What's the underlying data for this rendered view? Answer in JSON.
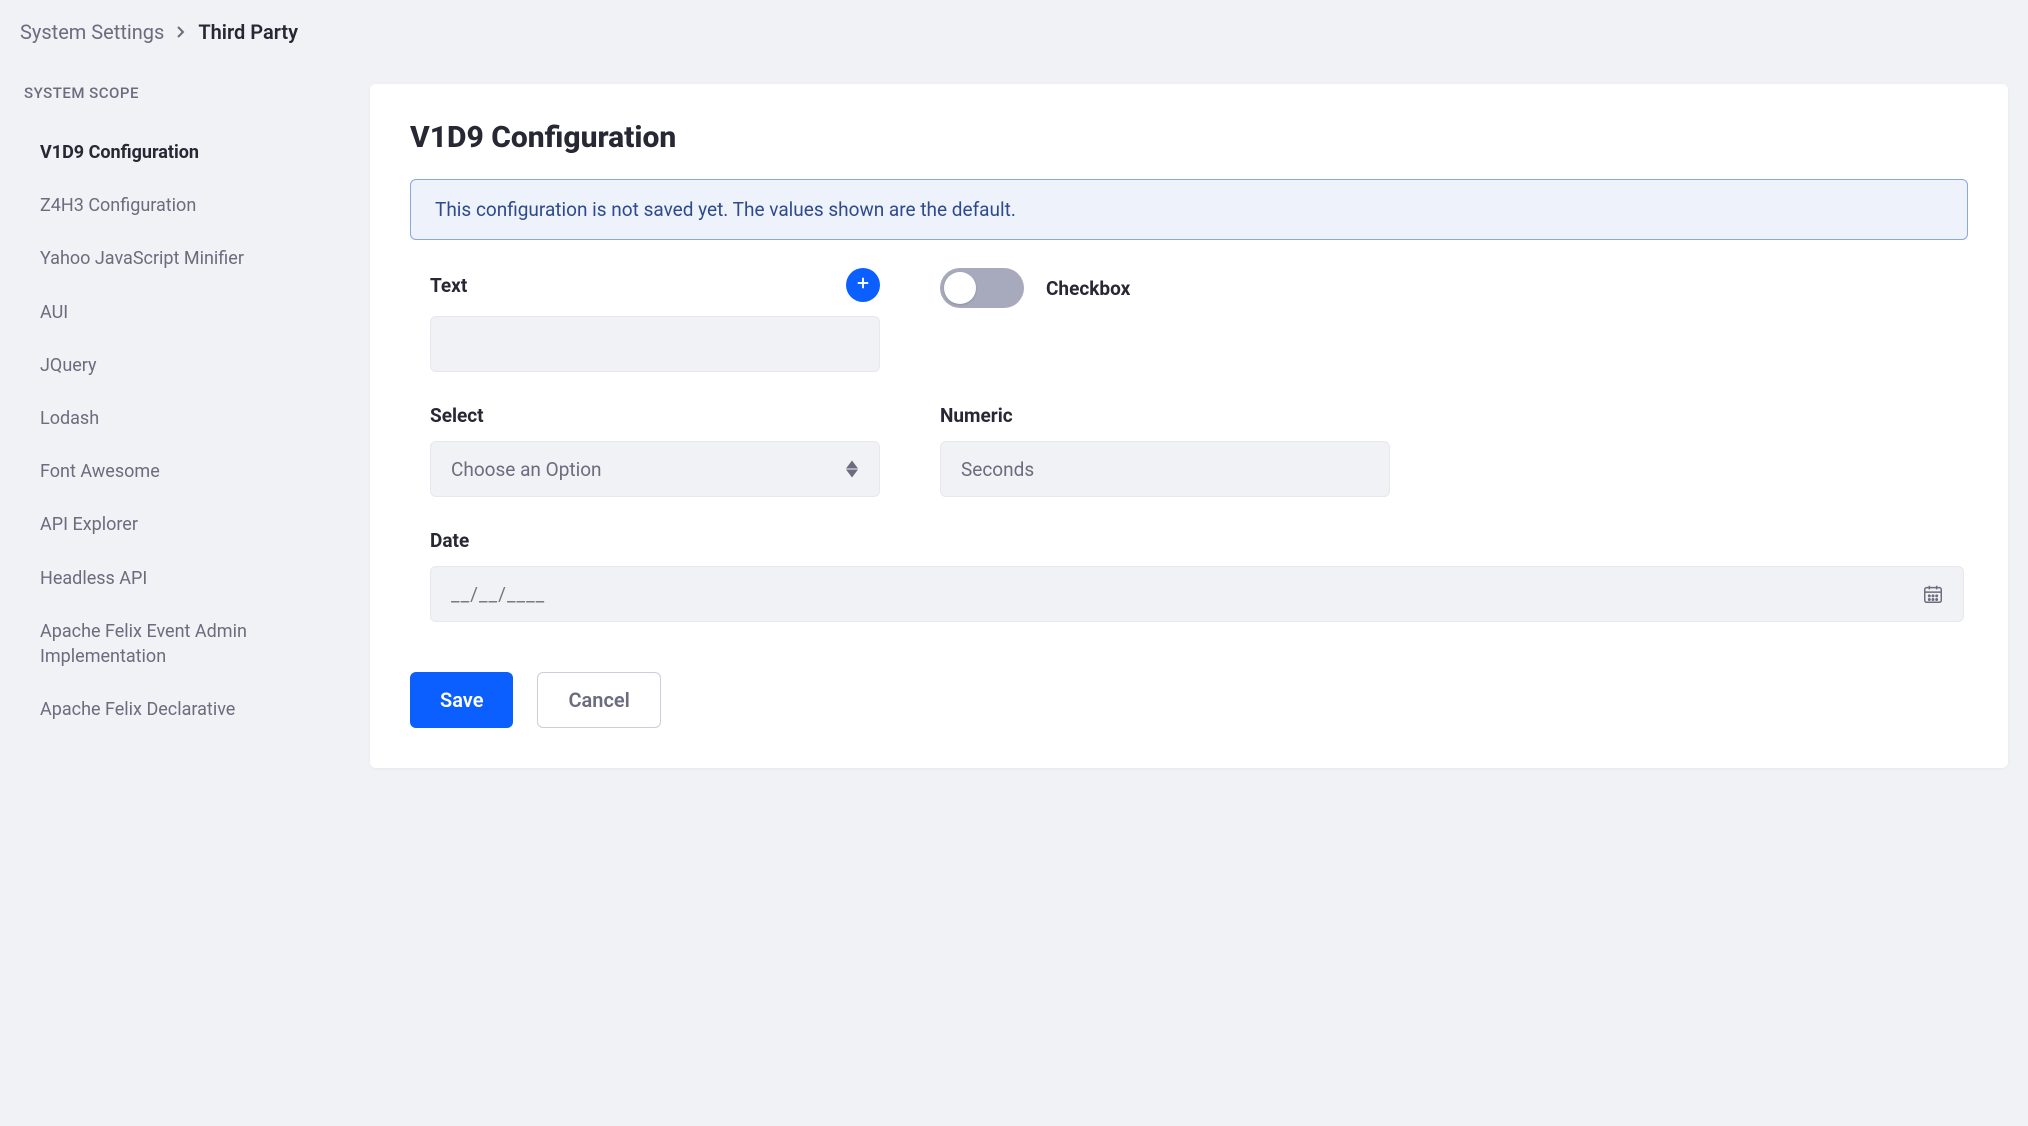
{
  "breadcrumb": {
    "parent": "System Settings",
    "current": "Third Party"
  },
  "sidebar": {
    "title": "SYSTEM SCOPE",
    "items": [
      {
        "label": "V1D9 Configuration",
        "active": true
      },
      {
        "label": "Z4H3 Configuration",
        "active": false
      },
      {
        "label": "Yahoo JavaScript Minifier",
        "active": false
      },
      {
        "label": "AUI",
        "active": false
      },
      {
        "label": "JQuery",
        "active": false
      },
      {
        "label": "Lodash",
        "active": false
      },
      {
        "label": "Font Awesome",
        "active": false
      },
      {
        "label": "API Explorer",
        "active": false
      },
      {
        "label": "Headless API",
        "active": false
      },
      {
        "label": "Apache Felix Event Admin Implementation",
        "active": false
      },
      {
        "label": "Apache Felix Declarative",
        "active": false
      }
    ]
  },
  "main": {
    "title": "V1D9 Configuration",
    "banner": "This configuration is not saved yet. The values shown are the default.",
    "fields": {
      "text": {
        "label": "Text",
        "value": ""
      },
      "checkbox": {
        "label": "Checkbox",
        "checked": false
      },
      "select": {
        "label": "Select",
        "placeholder": "Choose an Option"
      },
      "numeric": {
        "label": "Numeric",
        "placeholder": "Seconds",
        "value": ""
      },
      "date": {
        "label": "Date",
        "placeholder": "__/__/____",
        "value": ""
      }
    },
    "buttons": {
      "save": "Save",
      "cancel": "Cancel"
    }
  }
}
